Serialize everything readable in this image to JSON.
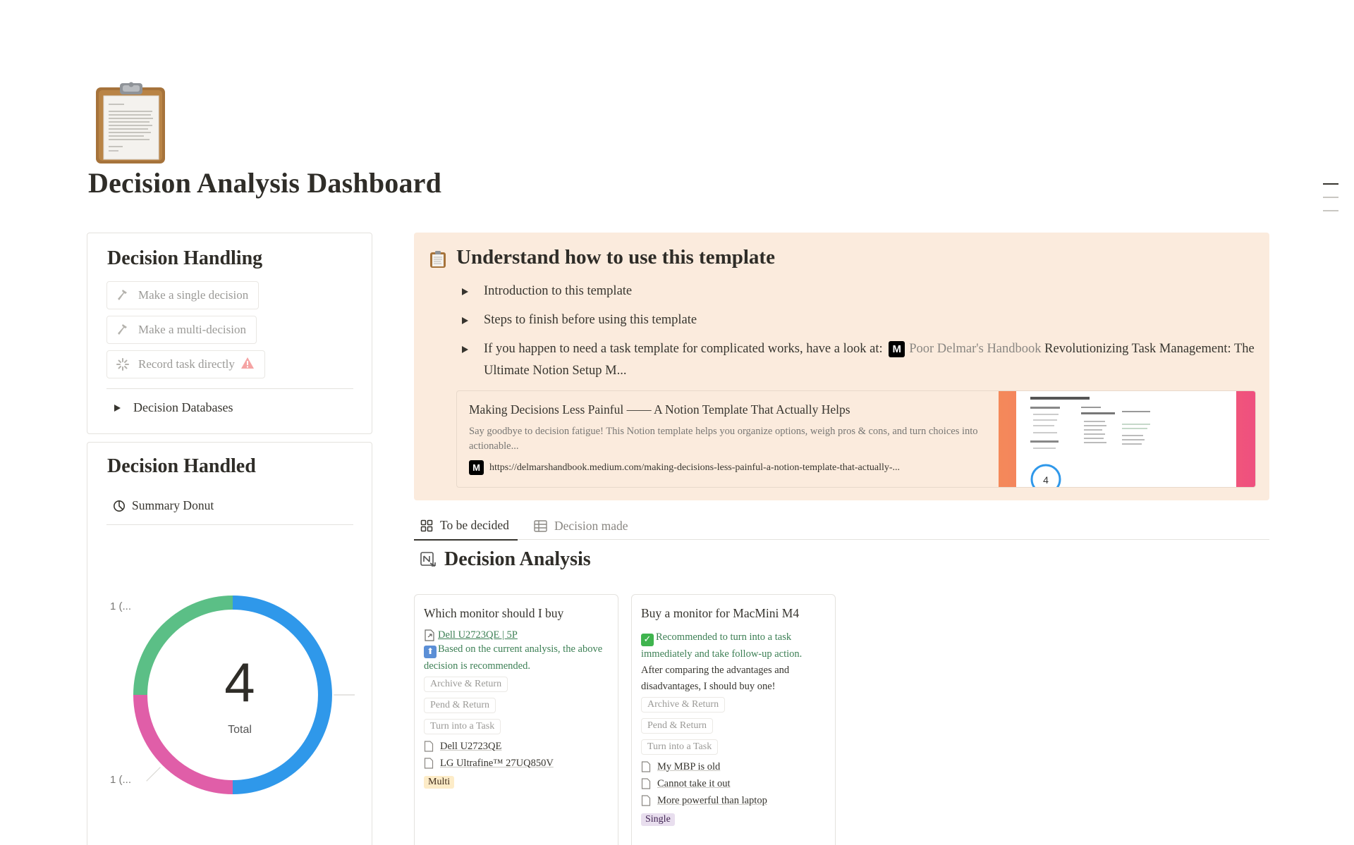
{
  "page": {
    "title": "Decision Analysis Dashboard",
    "icon": "clipboard-icon"
  },
  "handling": {
    "title": "Decision Handling",
    "buttons": [
      {
        "label": "Make a single decision",
        "icon": "hammer-icon"
      },
      {
        "label": "Make a multi-decision",
        "icon": "hammer-icon"
      },
      {
        "label": "Record task directly",
        "icon": "sparkle-icon",
        "badge": "warning-icon"
      }
    ],
    "databases_toggle": "Decision Databases"
  },
  "handled": {
    "title": "Decision Handled",
    "view_label": "Summary Donut",
    "donut": {
      "total": "4",
      "total_label": "Total",
      "labels": [
        "1 (...",
        "1 (..."
      ]
    }
  },
  "chart_data": {
    "type": "pie",
    "variant": "donut",
    "center_value": 4,
    "center_label": "Total",
    "slice_values": [
      2,
      1,
      1
    ],
    "slice_colors": [
      "#2f98ea",
      "#e05ea8",
      "#5bbf86"
    ],
    "label_positions": [
      "left",
      "left",
      "right"
    ]
  },
  "callout": {
    "title": "Understand how to use this template",
    "icon": "clipboard-icon",
    "toggles": [
      "Introduction to this template",
      "Steps to finish before using this template"
    ],
    "handbook": {
      "prefix": "If you happen to need a task template for complicated works, have a look at:",
      "mention": "Poor Delmar's Handbook",
      "suffix": "Revolutionizing Task Management: The Ultimate Notion Setup M..."
    },
    "bookmark": {
      "title": "Making Decisions Less Painful —— A Notion Template That Actually Helps",
      "description": "Say goodbye to decision fatigue! This Notion template helps you organize options, weigh pros & cons, and turn choices into actionable...",
      "url": "https://delmarshandbook.medium.com/making-decisions-less-painful-a-notion-template-that-actually-..."
    }
  },
  "tabs": [
    {
      "label": "To be decided",
      "icon": "board-icon",
      "active": true
    },
    {
      "label": "Decision made",
      "icon": "table-icon",
      "active": false
    }
  ],
  "section": {
    "title": "Decision Analysis"
  },
  "cards": [
    {
      "title": "Which monitor should I buy",
      "link": "Dell U2723QE | 5P",
      "note": "Based on the current analysis, the above decision is recommended.",
      "actions": [
        "Archive & Return",
        "Pend & Return",
        "Turn into a Task"
      ],
      "relations": [
        "Dell U2723QE",
        "LG Ultrafine™ 27UQ850V"
      ],
      "tag": "Multi"
    },
    {
      "title": "Buy a monitor for MacMini M4",
      "note": "Recommended to turn into a task immediately and take follow-up action.",
      "body": "After comparing the advantages and disadvantages, I should buy one!",
      "actions": [
        "Archive & Return",
        "Pend & Return",
        "Turn into a Task"
      ],
      "relations": [
        "My MBP is old",
        "Cannot take it out",
        "More powerful than laptop"
      ],
      "tag": "Single"
    }
  ]
}
